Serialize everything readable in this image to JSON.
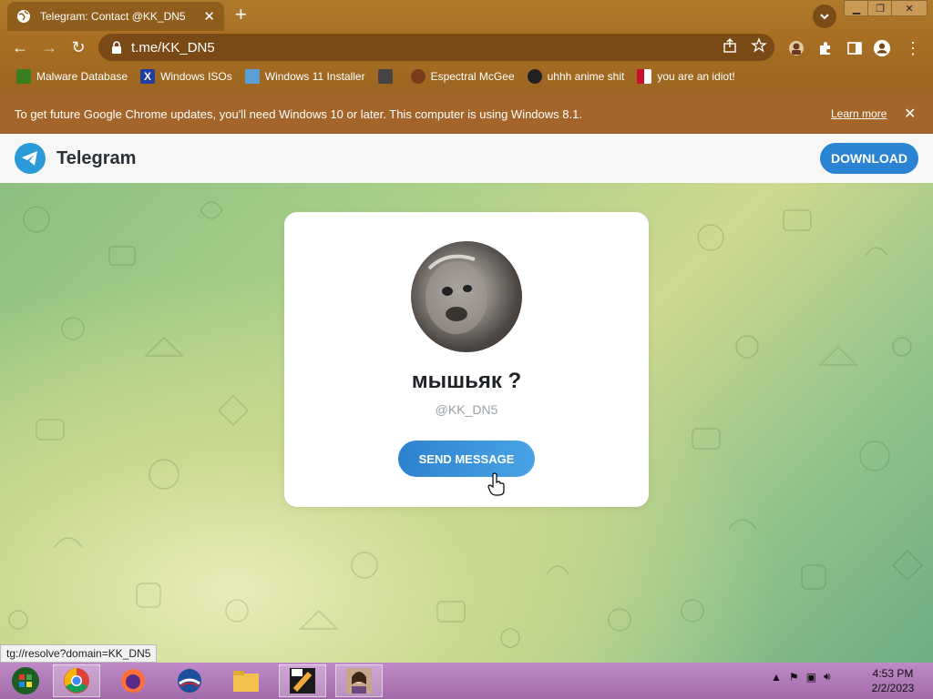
{
  "browser": {
    "tab_title": "Telegram: Contact @KK_DN5",
    "url": "t.me/KK_DN5",
    "bookmarks": [
      {
        "label": "Malware Database",
        "icon": "folder-icon",
        "color": "#3a7d1e"
      },
      {
        "label": "Windows ISOs",
        "icon": "x-logo-icon",
        "color": "#1e3fa0"
      },
      {
        "label": "Windows 11 Installer",
        "icon": "installer-icon",
        "color": "#5aa0d8"
      },
      {
        "label": "",
        "icon": "site-icon",
        "color": "#444444"
      },
      {
        "label": "Espectral McGee",
        "icon": "avatar-icon",
        "color": "#7a3b1a"
      },
      {
        "label": "uhhh anime shit",
        "icon": "anime-icon",
        "color": "#222222"
      },
      {
        "label": "you are an idiot!",
        "icon": "flag-icon",
        "color": "#c8102e"
      }
    ],
    "infobar_text": "To get future Google Chrome updates, you'll need Windows 10 or later. This computer is using Windows 8.1.",
    "infobar_link": "Learn more",
    "status_url": "tg://resolve?domain=KK_DN5"
  },
  "telegram": {
    "brand": "Telegram",
    "download_label": "DOWNLOAD",
    "contact_name": "мышьяк ?",
    "contact_handle": "@KK_DN5",
    "send_label": "SEND MESSAGE"
  },
  "taskbar": {
    "time": "4:53 PM",
    "date": "2/2/2023"
  }
}
